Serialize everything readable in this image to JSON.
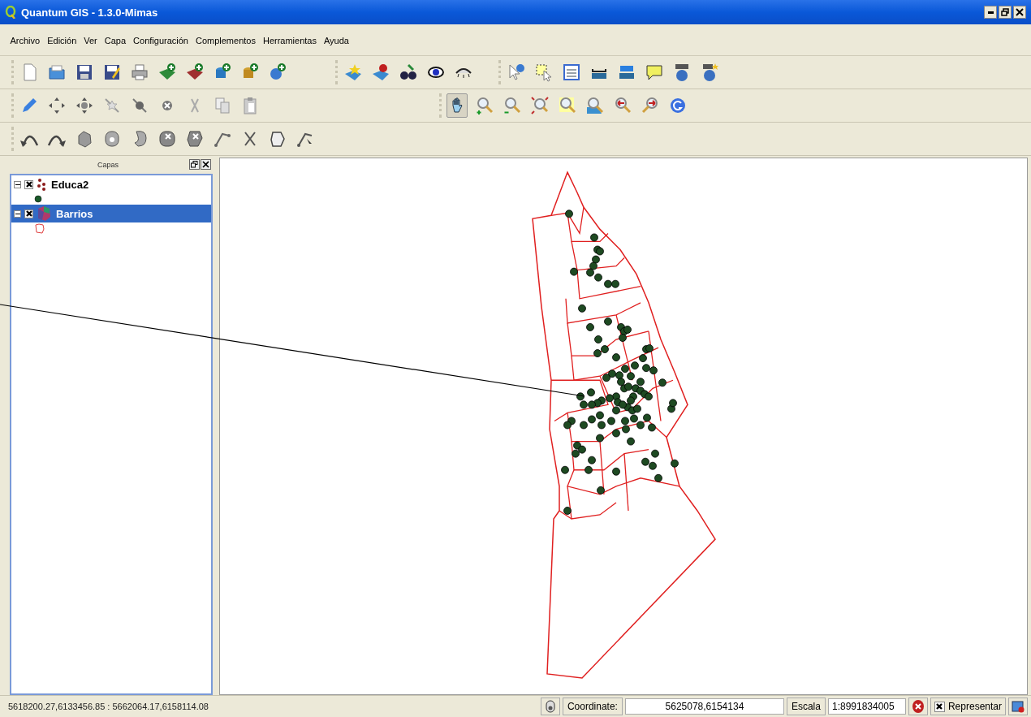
{
  "window": {
    "title": "Quantum GIS - 1.3.0-Mimas"
  },
  "menu": [
    "Archivo",
    "Edición",
    "Ver",
    "Capa",
    "Configuración",
    "Complementos",
    "Herramientas",
    "Ayuda"
  ],
  "map_tools": [
    {
      "selected": true
    },
    {
      "selected": false
    },
    {
      "selected": false
    },
    {
      "selected": false
    },
    {
      "selected": false
    },
    {
      "selected": false
    },
    {
      "selected": false
    },
    {
      "selected": false
    },
    {
      "selected": false
    }
  ],
  "layers_panel": {
    "title": "Capas",
    "layers": [
      {
        "name": "Educa2",
        "kind": "points",
        "checked": true,
        "expanded": true,
        "selected": false
      },
      {
        "name": "Barrios",
        "kind": "polygons",
        "checked": true,
        "expanded": true,
        "selected": true
      }
    ]
  },
  "status_bar": {
    "extent": "5618200.27,6133456.85 : 5662064.17,6158114.08",
    "coordinate_label": "Coordinate:",
    "coordinate": "5625078,6154134",
    "scale_label": "Escala",
    "scale": "1:8991834005",
    "render_label": "Representar",
    "render_checked": true
  }
}
